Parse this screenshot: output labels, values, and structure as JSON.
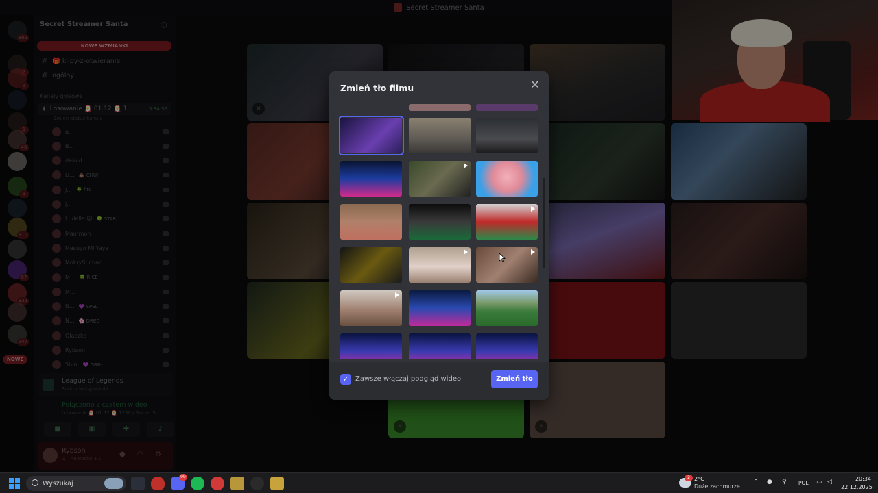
{
  "window": {
    "title": "Secret Streamer Santa"
  },
  "servers": [
    {
      "badge": "802",
      "color": "#2c2f33"
    },
    {
      "badge": "2",
      "color": "#3a2b2c"
    },
    {
      "badge": "1",
      "color": "#8a2a2a"
    },
    {
      "badge": "",
      "color": "#1f2a3a"
    },
    {
      "badge": "1",
      "color": "#3c2a28"
    },
    {
      "badge": "46",
      "color": "#6a4f48"
    },
    {
      "badge": "",
      "color": "#b9b6b2"
    },
    {
      "badge": "1",
      "color": "#3d7a2c"
    },
    {
      "badge": "",
      "color": "#2a3b4a"
    },
    {
      "badge": "310",
      "color": "#8a7a2a"
    },
    {
      "badge": "",
      "color": "#5a5a5a"
    },
    {
      "badge": "67",
      "color": "#7a3cc0"
    },
    {
      "badge": "332",
      "color": "#b0353a"
    },
    {
      "badge": "",
      "color": "#6a4d45"
    },
    {
      "badge": "247",
      "color": "#5a5a52"
    }
  ],
  "server_nowe_label": "NOWE",
  "sidebar": {
    "guild_name": "Secret Streamer Santa",
    "new_mentions": "NOWE WZMIANKI",
    "text_channels": [
      "🎁 klipy-z-otwierania",
      "ogólny"
    ],
    "voice_category": "Kanały głosowe",
    "voice_channel": {
      "name": "Losowanie 🎅 01.12 🎅 1...",
      "time": "3:34:36",
      "status": "Zmień status kanału"
    },
    "members": [
      {
        "name": "a...",
        "tag": ""
      },
      {
        "name": "B...",
        "tag": ""
      },
      {
        "name": "deloid",
        "tag": ""
      },
      {
        "name": "D...",
        "tag": "💩 CHUJ"
      },
      {
        "name": "J...",
        "tag": "🍀 fitq"
      },
      {
        "name": "j...",
        "tag": ""
      },
      {
        "name": "Ludella 🐱",
        "tag": "🍀 STAR"
      },
      {
        "name": "Mammon",
        "tag": ""
      },
      {
        "name": "Masuyo Mi Yaya",
        "tag": ""
      },
      {
        "name": "MokrySuchar",
        "tag": ""
      },
      {
        "name": "M...",
        "tag": "🍀 RICE"
      },
      {
        "name": "M...",
        "tag": ""
      },
      {
        "name": "N...",
        "tag": "💜 SPEL"
      },
      {
        "name": "N...",
        "tag": "🌸 DRED"
      },
      {
        "name": "Olaczka",
        "tag": ""
      },
      {
        "name": "Rybson",
        "tag": ""
      },
      {
        "name": "Shini",
        "tag": "💜 GRR-"
      }
    ],
    "activity": {
      "title": "League of Legends",
      "subtitle": "Brak udostępniania"
    },
    "connection": {
      "title": "Połączono z czatem wideo",
      "subtitle": "Losowanie 🎅 01.12 🎅 1230 / Secret Str..."
    },
    "user": {
      "name": "Rybson",
      "status": "♫ The Rooks +1"
    }
  },
  "modal": {
    "title": "Zmień tło filmu",
    "close_label": "✕",
    "checkbox_label": "Zawsze włączaj podgląd wideo",
    "checkbox_checked": true,
    "submit_label": "Zmień tło",
    "thumbnails": [
      {
        "name": "thumb-room-purple",
        "bg": "linear-gradient(135deg,#1b1440,#6a3fb0 60%,#2a1f5a)",
        "video": false,
        "selected": true
      },
      {
        "name": "thumb-bedroom",
        "bg": "linear-gradient(180deg,#8a8070,#5e5a54 60%,#3a3836)",
        "video": false,
        "selected": false
      },
      {
        "name": "thumb-gamers",
        "bg": "linear-gradient(180deg,#2a2e33,#4a4a4e 60%,#1a1a1c)",
        "video": false,
        "selected": false
      },
      {
        "name": "thumb-neon-blue",
        "bg": "linear-gradient(180deg,#0a1430,#1c3ca0 50%,#d02a8a)",
        "video": false,
        "selected": false
      },
      {
        "name": "thumb-people-outdoor",
        "bg": "linear-gradient(135deg,#3a4a2a,#6a6a50 50%,#222)",
        "video": true,
        "selected": false
      },
      {
        "name": "thumb-pink-meme",
        "bg": "radial-gradient(circle at 50% 45%,#f2b0b8,#e08a98 40%,#3aa0e8 75%)",
        "video": false,
        "selected": false
      },
      {
        "name": "thumb-man-room",
        "bg": "linear-gradient(180deg,#8a6a50,#b0806a 50%,#c07060)",
        "video": false,
        "selected": false
      },
      {
        "name": "thumb-desk-setup",
        "bg": "linear-gradient(180deg,#0c0c0c,#3a3a3a 50%,#1a6a3a)",
        "video": false,
        "selected": false
      },
      {
        "name": "thumb-santa-dance",
        "bg": "linear-gradient(180deg,#d0d0d0,#c02a2a 50%,#2a8a4a)",
        "video": true,
        "selected": false
      },
      {
        "name": "thumb-dark-yellow",
        "bg": "linear-gradient(135deg,#141414,#6a5a10 50%,#1a1a1a)",
        "video": false,
        "selected": false
      },
      {
        "name": "thumb-woman-light",
        "bg": "linear-gradient(180deg,#b0a090,#e0d0c8 55%,#9a8070)",
        "video": true,
        "selected": false
      },
      {
        "name": "thumb-hair-closeup",
        "bg": "linear-gradient(135deg,#6a4a3a,#a08070 50%,#3a2a22)",
        "video": true,
        "selected": false
      },
      {
        "name": "thumb-woman-indoor",
        "bg": "linear-gradient(180deg,#d0c8c0,#a08070 55%,#6a5040)",
        "video": true,
        "selected": false
      },
      {
        "name": "thumb-neon-studio",
        "bg": "linear-gradient(180deg,#0a1a40,#2a4ab0 50%,#c02a9a)",
        "video": false,
        "selected": false
      },
      {
        "name": "thumb-football-field",
        "bg": "linear-gradient(180deg,#a0c8e8 0%,#7a9a6a 35%,#3a7a3a 60%,#2a6a2a)",
        "video": false,
        "selected": false
      },
      {
        "name": "thumb-neon-a",
        "bg": "linear-gradient(180deg,#0a1440,#3a3ab0 50%,#d02aa0)",
        "video": false,
        "selected": false
      },
      {
        "name": "thumb-neon-b",
        "bg": "linear-gradient(180deg,#0a1440,#3a3ab0 50%,#d02aa0)",
        "video": false,
        "selected": false
      },
      {
        "name": "thumb-neon-c",
        "bg": "linear-gradient(180deg,#0a1440,#3a3ab0 50%,#d02aa0)",
        "video": false,
        "selected": false
      }
    ]
  },
  "taskbar": {
    "search_placeholder": "Wyszukaj",
    "discord_badge": "99",
    "weather_temp": "2°C",
    "weather_desc": "Duże zachmurze...",
    "weather_badge": "2",
    "language": "POL",
    "time": "20:34",
    "date": "22.12.2025"
  }
}
